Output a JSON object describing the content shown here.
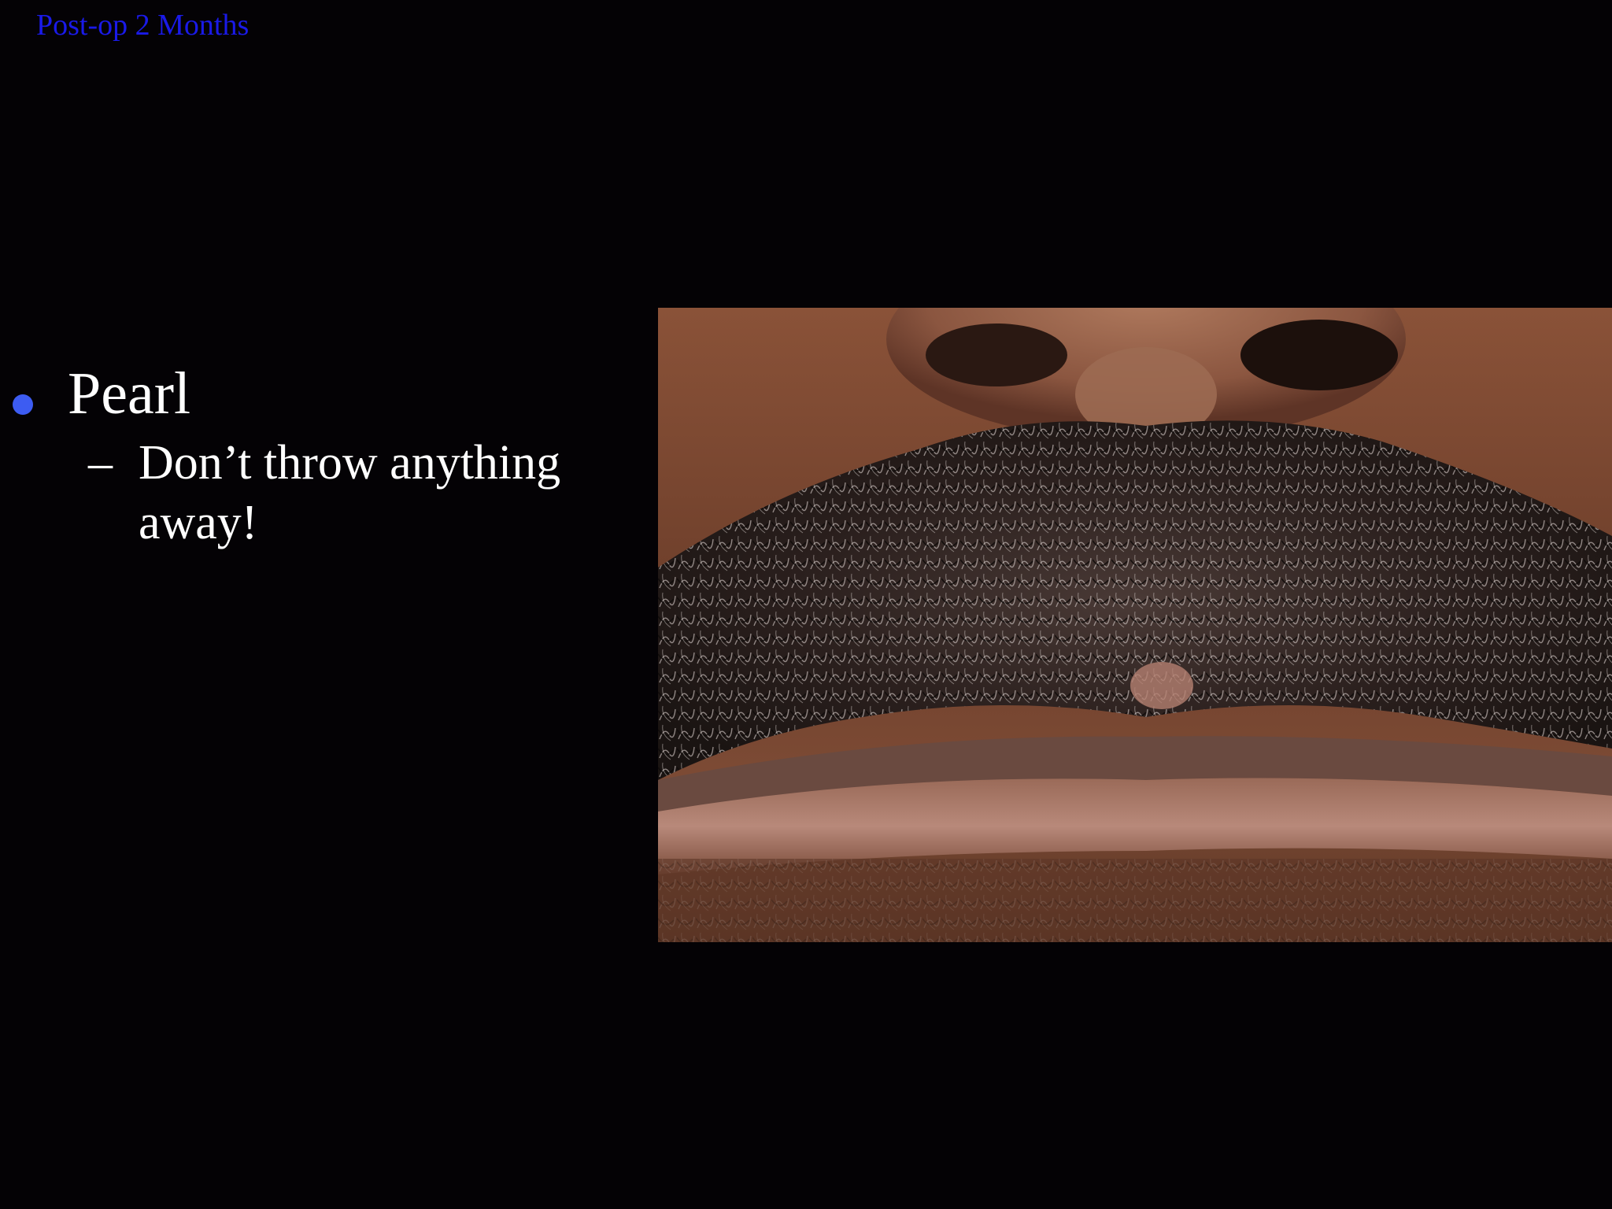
{
  "slide": {
    "title": "Post-op 2 Months",
    "bullets": [
      {
        "text": "Pearl",
        "sub": [
          {
            "text": "Don’t throw anything away!"
          }
        ]
      }
    ]
  },
  "colors": {
    "background": "#040205",
    "title": "#1a1ae8",
    "bullet": "#3d5cf2",
    "body_text": "#ffffff"
  },
  "photo": {
    "description_icon": "clinical-photo"
  }
}
